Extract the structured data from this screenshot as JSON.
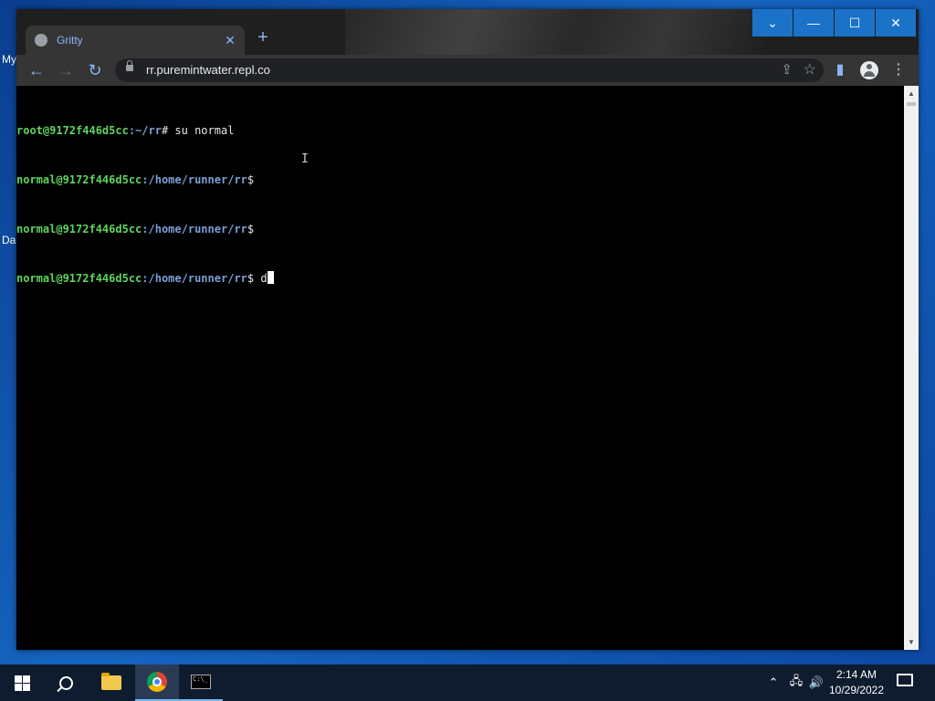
{
  "desktop": {
    "labels": [
      "My",
      "Da"
    ]
  },
  "browser": {
    "tab_title": "Gritty",
    "new_tab_symbol": "+",
    "url": "rr.puremintwater.repl.co",
    "window_buttons": {
      "dropdown": "⌄",
      "minimize": "—",
      "maximize": "☐",
      "close": "✕"
    }
  },
  "terminal": {
    "lines": [
      {
        "user": "root@9172f446d5cc",
        "path": ":~/rr",
        "prompt": "#",
        "command": " su normal"
      },
      {
        "user": "normal@9172f446d5cc",
        "path": ":/home/runner/rr",
        "prompt": "$",
        "command": ""
      },
      {
        "user": "normal@9172f446d5cc",
        "path": ":/home/runner/rr",
        "prompt": "$",
        "command": ""
      },
      {
        "user": "normal@9172f446d5cc",
        "path": ":/home/runner/rr",
        "prompt": "$",
        "command": " d"
      }
    ]
  },
  "taskbar": {
    "time": "2:14 AM",
    "date": "10/29/2022"
  },
  "icons": {
    "back": "back-arrow-icon",
    "forward": "forward-arrow-icon",
    "reload": "reload-icon",
    "lock": "lock-icon",
    "share": "share-icon",
    "star": "bookmark-star-icon",
    "sidepanel": "side-panel-icon",
    "profile": "profile-avatar-icon",
    "menu": "kebab-menu-icon"
  },
  "colors": {
    "titlebar_button": "#1a73c9",
    "terminal_user": "#5fd35f",
    "terminal_path": "#7a9fd8",
    "link_blue": "#8ab4f8"
  }
}
